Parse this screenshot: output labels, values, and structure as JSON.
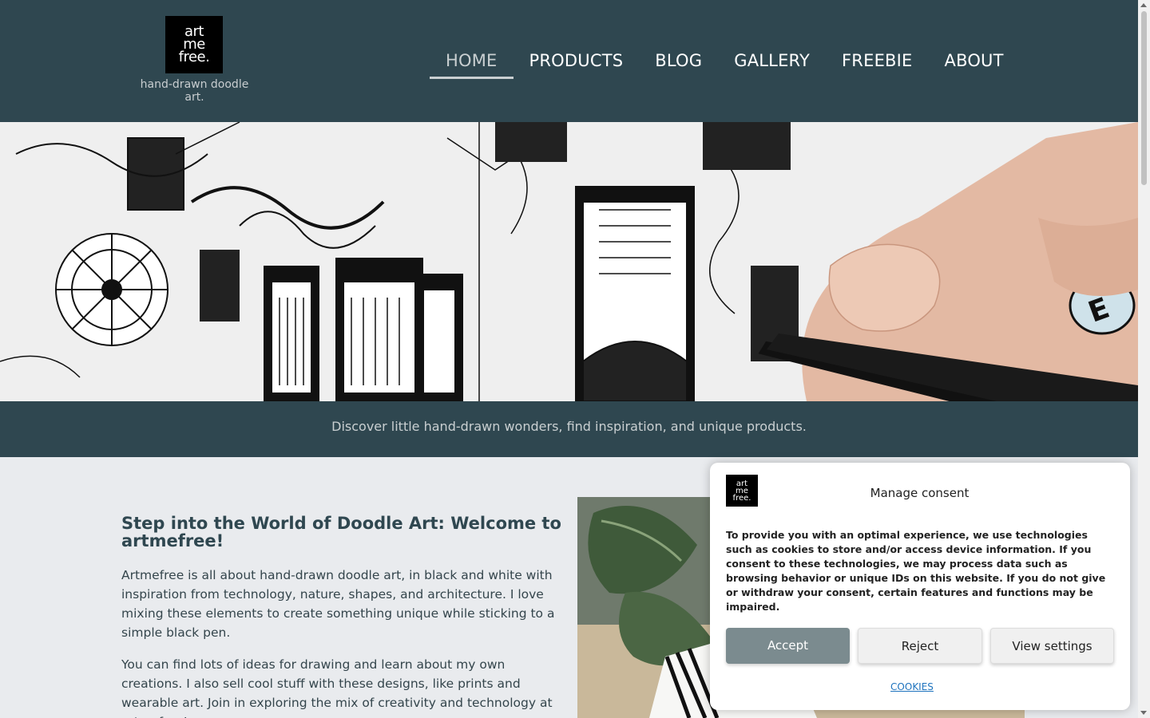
{
  "site": {
    "logo_lines": [
      "art",
      "me",
      "free."
    ],
    "tagline": "hand-drawn doodle art."
  },
  "nav": {
    "items": [
      {
        "label": "HOME",
        "active": true
      },
      {
        "label": "PRODUCTS"
      },
      {
        "label": "BLOG"
      },
      {
        "label": "GALLERY"
      },
      {
        "label": "FREEBIE"
      },
      {
        "label": "ABOUT"
      }
    ]
  },
  "hero": {
    "subtitle": "Discover little hand-drawn wonders, find inspiration, and unique products."
  },
  "content": {
    "title": "Step into the World of Doodle Art: Welcome to artmefree!",
    "paragraph1": "Artmefree is all about hand-drawn doodle art, in black and white with inspiration from technology, nature, shapes, and architecture. I love mixing these elements to create something unique while sticking to a simple black pen.",
    "paragraph2": "You can find lots of ideas for drawing and learn about my own creations. I also sell cool stuff with these designs, like prints and wearable art. Join in exploring the mix of creativity and technology at artmefree!"
  },
  "consent": {
    "title": "Manage consent",
    "text": "To provide you with an optimal experience, we use technologies such as cookies to store and/or access device information. If you consent to these technologies, we may process data such as browsing behavior or unique IDs on this website. If you do not give or withdraw your consent, certain features and functions may be impaired.",
    "accept_label": "Accept",
    "reject_label": "Reject",
    "settings_label": "View settings",
    "cookies_link": "COOKIES"
  },
  "colors": {
    "header_bg": "#2f4750",
    "page_bg": "#e9ebee",
    "accept_bg": "#7b8b8f"
  }
}
